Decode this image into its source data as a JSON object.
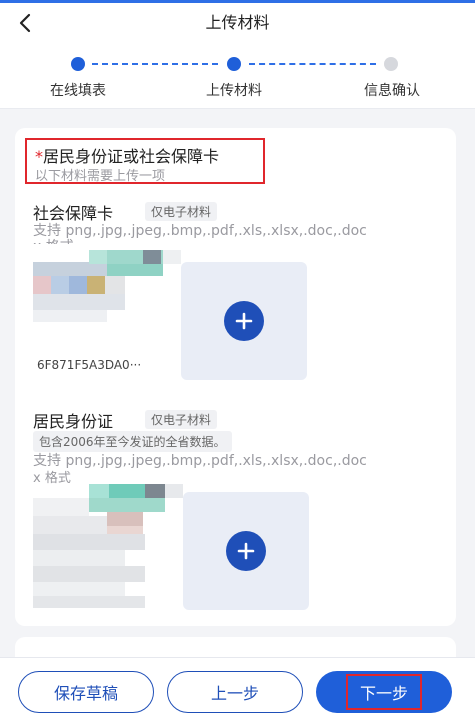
{
  "header": {
    "title": "上传材料",
    "back_icon": "chevron-left-icon"
  },
  "steps": [
    {
      "label": "在线填表",
      "state": "done"
    },
    {
      "label": "上传材料",
      "state": "active"
    },
    {
      "label": "信息确认",
      "state": "pending"
    }
  ],
  "requirement": {
    "star": "*",
    "title": "居民身份证或社会保障卡",
    "subtitle": "以下材料需要上传一项"
  },
  "materials": [
    {
      "title": "社会保障卡",
      "tag": "仅电子材料",
      "formats": "支持 png,.jpg,.jpeg,.bmp,.pdf,.xls,.xlsx,.doc,.doc",
      "formats_overflow": "x 格式",
      "file_name": "6F871F5A3DA0···"
    },
    {
      "title": "居民身份证",
      "tag": "仅电子材料",
      "note": "包含2006年至今发证的全省数据。",
      "formats": "支持 png,.jpg,.jpeg,.bmp,.pdf,.xls,.xlsx,.doc,.doc",
      "formats_overflow": "x 格式"
    }
  ],
  "footer": {
    "save_draft": "保存草稿",
    "prev": "上一步",
    "next": "下一步"
  },
  "colors": {
    "primary": "#1f5fd9",
    "highlight_red": "#e0262c",
    "inactive_dot": "#d6d8dd"
  }
}
